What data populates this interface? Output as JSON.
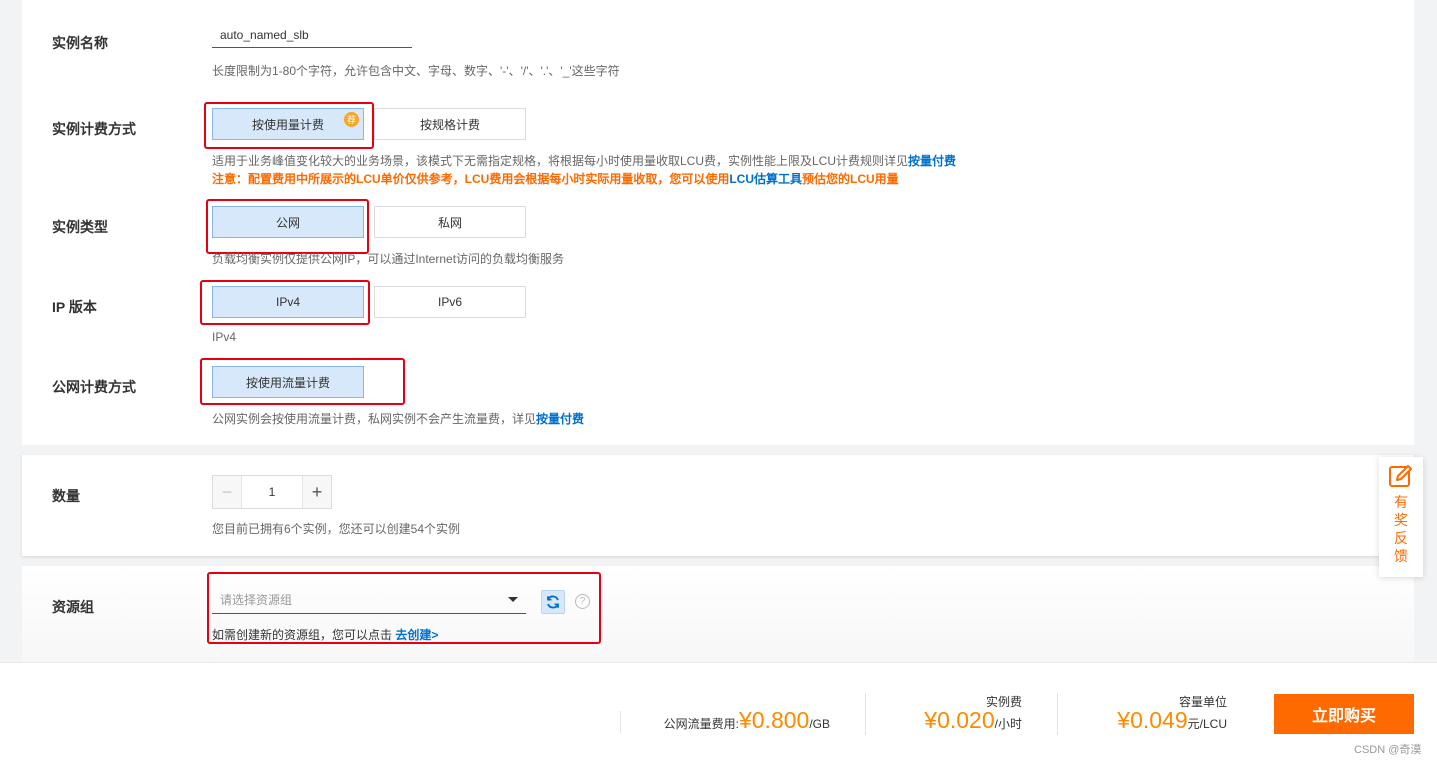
{
  "instance_name": {
    "label": "实例名称",
    "value": "auto_named_slb",
    "help": "长度限制为1-80个字符，允许包含中文、字母、数字、'-'、'/'、'.'、'_'这些字符"
  },
  "billing_method": {
    "label": "实例计费方式",
    "options": [
      "按使用量计费",
      "按规格计费"
    ],
    "selected": "按使用量计费",
    "badge": "荐",
    "help_prefix": "适用于业务峰值变化较大的业务场景，该模式下无需指定规格，将根据每小时使用量收取LCU费，实例性能上限及LCU计费规则详见",
    "help_link": "按量付费",
    "warn_prefix": "注意：配置费用中所展示的LCU单价仅供参考，LCU费用会根据每小时实际用量收取，您可以使用",
    "warn_link": "LCU估算工具",
    "warn_suffix": "预估您的LCU用量"
  },
  "instance_type": {
    "label": "实例类型",
    "options": [
      "公网",
      "私网"
    ],
    "selected": "公网",
    "help": "负载均衡实例仅提供公网IP，可以通过Internet访问的负载均衡服务"
  },
  "ip_version": {
    "label": "IP 版本",
    "options": [
      "IPv4",
      "IPv6"
    ],
    "selected": "IPv4",
    "help": "IPv4"
  },
  "public_billing": {
    "label": "公网计费方式",
    "option": "按使用流量计费",
    "help_prefix": "公网实例会按使用流量计费，私网实例不会产生流量费，详见",
    "help_link": "按量付费"
  },
  "quantity": {
    "label": "数量",
    "minus": "−",
    "value": "1",
    "plus": "+",
    "help": "您目前已拥有6个实例，您还可以创建54个实例"
  },
  "resource_group": {
    "label": "资源组",
    "placeholder": "请选择资源组",
    "help_prefix": "如需创建新的资源组，您可以点击",
    "help_link": "去创建>",
    "question": "?"
  },
  "feedback": {
    "text": "有奖反馈"
  },
  "footer": {
    "traffic_label": "公网流量费用:",
    "traffic_amount": "¥0.800",
    "traffic_unit": "/GB",
    "instance_label": "实例费",
    "instance_amount": "¥0.020",
    "instance_unit": "/小时",
    "lcu_label": "容量单位",
    "lcu_amount": "¥0.049",
    "lcu_unit": "元/LCU",
    "buy_label": "立即购买",
    "watermark": "CSDN @奇漠"
  },
  "colors": {
    "accent_orange": "#ff6a00",
    "link_blue": "#0070cc",
    "selected_bg": "#d6e8fa",
    "highlight_red": "#e60012"
  }
}
